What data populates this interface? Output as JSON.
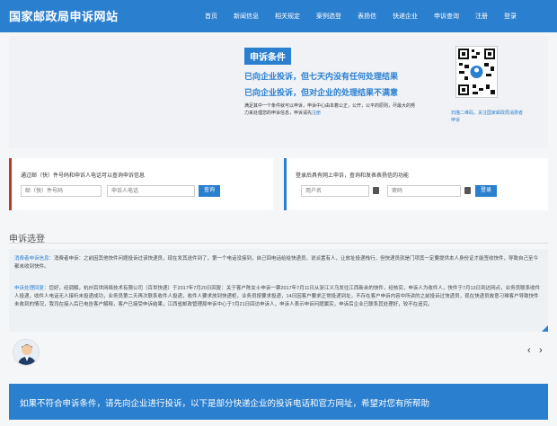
{
  "header": {
    "site_title": "国家邮政局申诉网站",
    "nav": [
      "首页",
      "新闻信息",
      "相关规定",
      "案例选登",
      "表扬信",
      "快递企业",
      "申诉查询",
      "注册",
      "登录"
    ]
  },
  "hero": {
    "title": "申诉条件",
    "line1": "已向企业投诉，但七天内没有任何处理结果",
    "line2": "已向企业投诉，但对企业的处理结果不满意",
    "note_text": "满足其中一个条件就可以申诉，申诉中心由本着公正，公开，公平的原则，尽最大的努力来处理您的申诉信息，申诉请先",
    "note_link": "注册",
    "qr_caption": "扫描二维码，关注国家邮政局消费者申诉"
  },
  "query_left": {
    "label": "通过邮（快）件号码和申诉人电话可以查询申诉信息",
    "input1_placeholder": "邮（快）件号码",
    "input2_placeholder": "申诉人电话",
    "button": "查询"
  },
  "query_right": {
    "label": "登录后具有网上申诉，查询和发表表扬信的功能",
    "input1_placeholder": "用户名",
    "input2_placeholder": "密码",
    "button": "登录"
  },
  "cases": {
    "section_title": "申诉选登",
    "p1_tag": "消费者申诉信息：",
    "p1_text": "消费者申诉：之前因其他快件问题投诉过该快递员，现在发其送件到了，第一个电话没接到，自己回电话给给快递员，说派置有人，让放址投递栈行，但快递员就是门项其一定要提供本人身份证才能签收快件，导致自己至今都未收到快件。",
    "p2_tag": "申诉处理回复：",
    "p2_text": "您好，经调解，杭州百世网络技术有限公司（百世快递）于2017年7月20日回复：关于客户陈女士申诉一票2017年7月11日从浙江义乌发往江西新余的快件，经核实，申诉人为收件人，快件于7月13日到达网点，业务员联系收件人投递，收件人电话无人接听未投递成功，业务员第二天再次联系收件人投递，收件人要求放到快递柜，业务员按要求投递，14日因客户要求正常投递到址，不存在客户申诉内容中所讲的之前投诉过快递员，现在快递员故意刁难客户导致快件未收到的情况，我司在接入后已电告客户解释，客户已接受申诉结果，江西省邮政管理局申诉中心于7月21日回访申诉人，申诉人表示申诉问题属实，申诉后企业已联系其处理好，较不在追究。"
  },
  "carousel": {
    "prev": "‹",
    "next": "›"
  },
  "bottom": {
    "text": "如果不符合申诉条件，请先向企业进行投诉，以下是部分快递企业的投诉电话和官方网址，希望对您有所帮助"
  },
  "colors": {
    "brand": "#2a7fcf",
    "accent_red": "#c0392b"
  },
  "icons": {
    "avatar": "person-avatar-icon",
    "lock": "lock-icon",
    "qr": "qr-code-icon"
  }
}
